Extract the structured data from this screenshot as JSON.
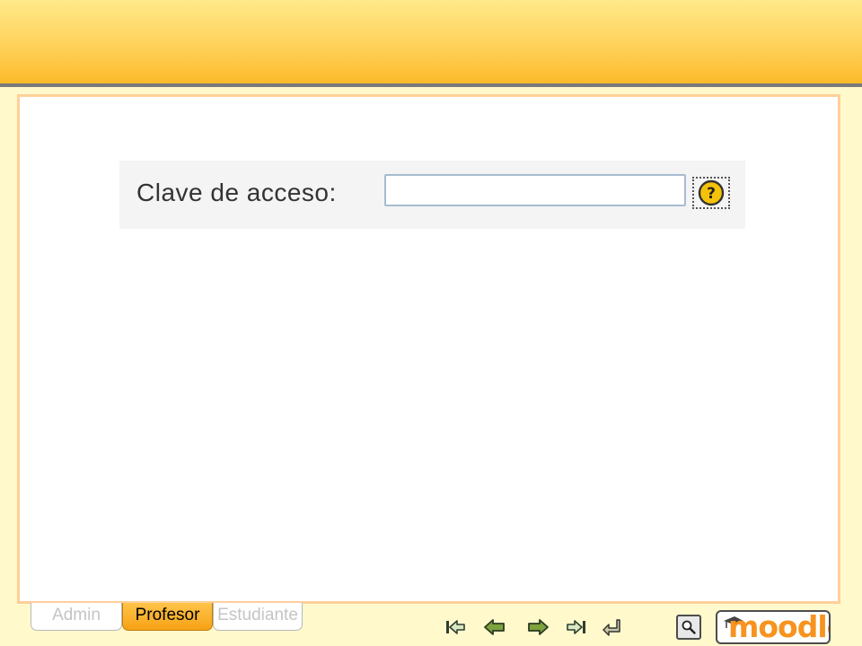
{
  "form": {
    "label": "Clave de acceso:",
    "input_value": "",
    "input_placeholder": ""
  },
  "role_tabs": [
    {
      "label": "Admin",
      "active": false
    },
    {
      "label": "Profesor",
      "active": true
    },
    {
      "label": "Estudiante",
      "active": false
    }
  ],
  "navigation": [
    "first-icon",
    "previous-icon",
    "next-icon",
    "last-icon",
    "return-icon"
  ],
  "branding": {
    "logo_text": "moodle"
  },
  "colors": {
    "banner_top": "#ffe98a",
    "banner_bottom": "#fcba2a",
    "active_tab": "#f6a215",
    "frame_border": "#ffd09a",
    "page_bg": "#fff9cc",
    "logo_orange": "#f7931e"
  }
}
